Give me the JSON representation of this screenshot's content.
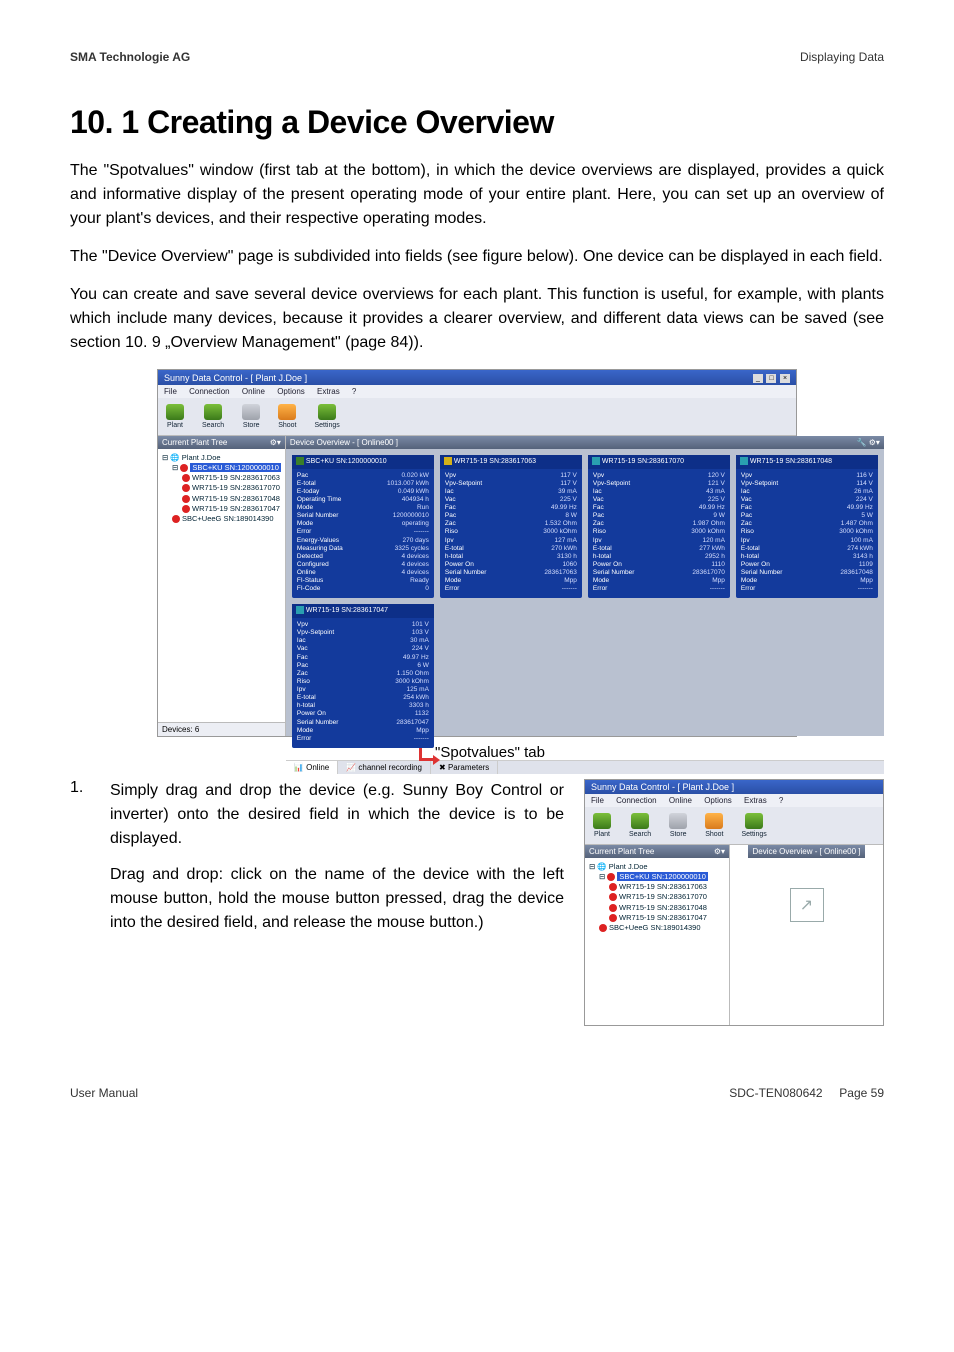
{
  "header": {
    "left": "SMA Technologie AG",
    "right": "Displaying Data"
  },
  "heading": "10. 1 Creating a Device Overview",
  "para1": "The \"Spotvalues\" window (first tab at the bottom), in which the device overviews are displayed, provides a quick and informative display of the present operating mode of your entire plant. Here, you can set up an overview of your plant's devices, and their respective operating modes.",
  "para2": "The \"Device Overview\" page is subdivided into fields (see figure below). One device can be displayed in each field.",
  "para3": "You can create and save several device overviews for each plant. This function is useful, for example, with plants which include many devices, because it provides a clearer overview, and different data views can be saved (see section 10. 9 „Overview Management\" (page 84)).",
  "screenshot": {
    "title": "Sunny Data Control - [ Plant J.Doe ]",
    "menu": [
      "File",
      "Connection",
      "Online",
      "Options",
      "Extras",
      "?"
    ],
    "tools": [
      "Plant",
      "Search",
      "Store",
      "Shoot",
      "Settings"
    ],
    "leftHeader": "Current Plant Tree",
    "devOverview": "Device Overview - [ Online00 ]",
    "tree": {
      "root": "Plant J.Doe",
      "sel": "SBC+KU SN:1200000010",
      "items": [
        "WR715-19 SN:283617063",
        "WR715-19 SN:283617070",
        "WR715-19 SN:283617048",
        "WR715-19 SN:283617047"
      ],
      "last": "SBC+UeeG SN:189014390"
    },
    "devCount": "Devices: 6",
    "card0": {
      "title": "SBC+KU SN:1200000010",
      "rows": [
        [
          "Pac",
          "0.020 kW"
        ],
        [
          "E-total",
          "1013.007 kWh"
        ],
        [
          "E-today",
          "0.049 kWh"
        ],
        [
          "Operating Time",
          "404934 h"
        ],
        [
          "Mode",
          "Run"
        ],
        [
          "Serial Number",
          "1200000010"
        ],
        [
          "Mode",
          "operating"
        ],
        [
          "Error",
          "-------"
        ],
        [
          "Energy-Values",
          "270 days"
        ],
        [
          "Measuring Data",
          "3325 cycles"
        ],
        [
          "Detected",
          "4 devices"
        ],
        [
          "Configured",
          "4 devices"
        ],
        [
          "Online",
          "4 devices"
        ],
        [
          "FI-Status",
          "Ready"
        ],
        [
          "FI-Code",
          "0"
        ]
      ]
    },
    "card1": {
      "title": "WR715-19 SN:283617063",
      "rows": [
        [
          "Vpv",
          "117 V"
        ],
        [
          "Vpv-Setpoint",
          "117 V"
        ],
        [
          "Iac",
          "39 mA"
        ],
        [
          "Vac",
          "225 V"
        ],
        [
          "Fac",
          "49.99 Hz"
        ],
        [
          "Pac",
          "8 W"
        ],
        [
          "Zac",
          "1.532 Ohm"
        ],
        [
          "Riso",
          "3000 kOhm"
        ],
        [
          "Ipv",
          "127 mA"
        ],
        [
          "E-total",
          "270 kWh"
        ],
        [
          "h-total",
          "3130 h"
        ],
        [
          "Power On",
          "1060"
        ],
        [
          "Serial Number",
          "283617063"
        ],
        [
          "Mode",
          "Mpp"
        ],
        [
          "Error",
          "-------"
        ]
      ]
    },
    "card2": {
      "title": "WR715-19 SN:283617070",
      "rows": [
        [
          "Vpv",
          "120 V"
        ],
        [
          "Vpv-Setpoint",
          "121 V"
        ],
        [
          "Iac",
          "43 mA"
        ],
        [
          "Vac",
          "225 V"
        ],
        [
          "Fac",
          "49.99 Hz"
        ],
        [
          "Pac",
          "9 W"
        ],
        [
          "Zac",
          "1.987 Ohm"
        ],
        [
          "Riso",
          "3000 kOhm"
        ],
        [
          "Ipv",
          "120 mA"
        ],
        [
          "E-total",
          "277 kWh"
        ],
        [
          "h-total",
          "2952 h"
        ],
        [
          "Power On",
          "1110"
        ],
        [
          "Serial Number",
          "283617070"
        ],
        [
          "Mode",
          "Mpp"
        ],
        [
          "Error",
          "-------"
        ]
      ]
    },
    "card3": {
      "title": "WR715-19 SN:283617048",
      "rows": [
        [
          "Vpv",
          "116 V"
        ],
        [
          "Vpv-Setpoint",
          "114 V"
        ],
        [
          "Iac",
          "26 mA"
        ],
        [
          "Vac",
          "224 V"
        ],
        [
          "Fac",
          "49.99 Hz"
        ],
        [
          "Pac",
          "5 W"
        ],
        [
          "Zac",
          "1.487 Ohm"
        ],
        [
          "Riso",
          "3000 kOhm"
        ],
        [
          "Ipv",
          "100 mA"
        ],
        [
          "E-total",
          "274 kWh"
        ],
        [
          "h-total",
          "3143 h"
        ],
        [
          "Power On",
          "1109"
        ],
        [
          "Serial Number",
          "283617048"
        ],
        [
          "Mode",
          "Mpp"
        ],
        [
          "Error",
          "-------"
        ]
      ]
    },
    "card4": {
      "title": "WR715-19 SN:283617047",
      "rows": [
        [
          "Vpv",
          "101 V"
        ],
        [
          "Vpv-Setpoint",
          "103 V"
        ],
        [
          "Iac",
          "30 mA"
        ],
        [
          "Vac",
          "224 V"
        ],
        [
          "Fac",
          "49.97 Hz"
        ],
        [
          "Pac",
          "6 W"
        ],
        [
          "Zac",
          "1.150 Ohm"
        ],
        [
          "Riso",
          "3000 kOhm"
        ],
        [
          "Ipv",
          "125 mA"
        ],
        [
          "E-total",
          "254 kWh"
        ],
        [
          "h-total",
          "3303 h"
        ],
        [
          "Power On",
          "1132"
        ],
        [
          "Serial Number",
          "283617047"
        ],
        [
          "Mode",
          "Mpp"
        ],
        [
          "Error",
          "-------"
        ]
      ]
    },
    "tabs": [
      "Online",
      "channel recording",
      "Parameters"
    ]
  },
  "spotvaluesLabel": "\"Spotvalues\" tab",
  "step": {
    "num": "1.",
    "p1": "Simply drag and drop the device (e.g. Sunny Boy Control or inverter) onto the desired field in which the device is to be displayed.",
    "p2": "Drag and drop: click on the name of the device with the left mouse button, hold the mouse button pressed, drag the device into the desired field, and release the mouse button.)"
  },
  "small": {
    "title": "Sunny Data Control - [ Plant J.Doe ]"
  },
  "footer": {
    "left": "User Manual",
    "mid": "SDC-TEN080642",
    "right": "Page 59"
  }
}
